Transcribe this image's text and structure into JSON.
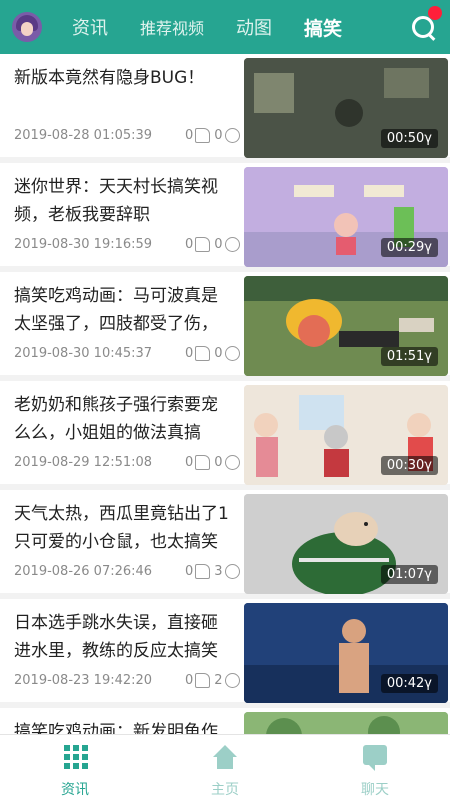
{
  "header": {
    "tabs": [
      "资讯",
      "推荐视频",
      "动图",
      "搞笑"
    ],
    "active_tab": "搞笑"
  },
  "items": [
    {
      "title": "新版本竟然有隐身BUG！",
      "date": "2019-08-28 01:05:39",
      "likes": "0",
      "comments": "0",
      "duration": "00:50γ"
    },
    {
      "title": "迷你世界：天天村长搞笑视频，老板我要辞职",
      "date": "2019-08-30 19:16:59",
      "likes": "0",
      "comments": "0",
      "duration": "00:29γ"
    },
    {
      "title": "搞笑吃鸡动画：马可波真是太坚强了，四肢都受了伤，",
      "date": "2019-08-30 10:45:37",
      "likes": "0",
      "comments": "0",
      "duration": "01:51γ"
    },
    {
      "title": "老奶奶和熊孩子强行索要宠么么，小姐姐的做法真搞",
      "date": "2019-08-29 12:51:08",
      "likes": "0",
      "comments": "0",
      "duration": "00:30γ"
    },
    {
      "title": "天气太热，西瓜里竟钻出了1只可爱的小仓鼠，也太搞笑",
      "date": "2019-08-26 07:26:46",
      "likes": "0",
      "comments": "3",
      "duration": "01:07γ"
    },
    {
      "title": "日本选手跳水失误，直接砸进水里，教练的反应太搞笑",
      "date": "2019-08-23 19:42:20",
      "likes": "0",
      "comments": "2",
      "duration": "00:42γ"
    },
    {
      "title": "搞笑吃鸡动画：新发明龟作",
      "date": "",
      "likes": "",
      "comments": "",
      "duration": ""
    }
  ],
  "nav": {
    "items": [
      "资讯",
      "主页",
      "聊天"
    ],
    "active": "资讯"
  },
  "colors": {
    "primary": "#26a591",
    "notification": "#ff1f3a"
  }
}
